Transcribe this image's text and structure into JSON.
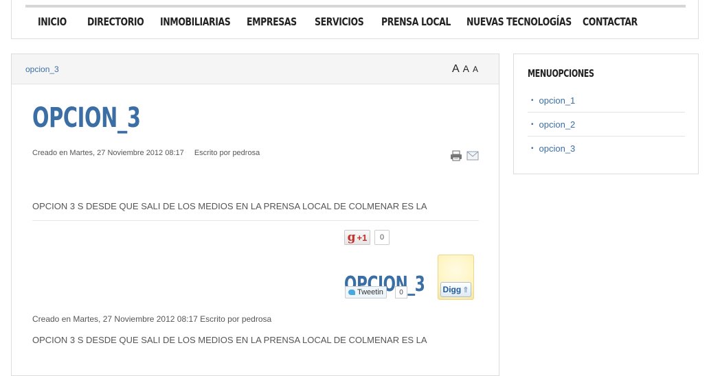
{
  "nav": {
    "items": [
      "Inicio",
      "Directorio",
      "Inmobiliarias",
      "Empresas",
      "Servicios",
      "Prensa local",
      "Nuevas tecnologías",
      "Contactar"
    ]
  },
  "breadcrumb": "opcion_3",
  "font_sizer": {
    "large": "A",
    "medium": "A",
    "small": "A"
  },
  "article": {
    "title": "OPCION_3",
    "created": "Creado en Martes, 27 Noviembre 2012 08:17",
    "author": "Escrito por pedrosa",
    "body": "OPCION 3   S DESDE QUE SALI DE LOS MEDIOS EN LA PRENSA LOCAL DE COLMENAR ES LA",
    "meta_repeat": "Creado en Martes, 27 Noviembre 2012 08:17 Escrito por pedrosa",
    "body_repeat": "OPCION 3   S DESDE QUE SALI DE LOS MEDIOS EN LA PRENSA LOCAL DE COLMENAR ES LA"
  },
  "social": {
    "gplus_label": "+1",
    "gplus_g": "g",
    "gplus_count": "0",
    "tweet_title": "OPCION_3",
    "tweet_label": "Tweetin",
    "tweet_count": "0",
    "digg_label": "Digg",
    "digg_arrow": "⇑"
  },
  "sidebar": {
    "title": "Menuopciones",
    "items": [
      "opcion_1",
      "opcion_2",
      "opcion_3"
    ]
  },
  "icons": {
    "print": "printer-icon",
    "email": "email-icon"
  },
  "colors": {
    "link": "#3a6ea5",
    "nav_text": "#222222",
    "border": "#dcdcdc"
  }
}
